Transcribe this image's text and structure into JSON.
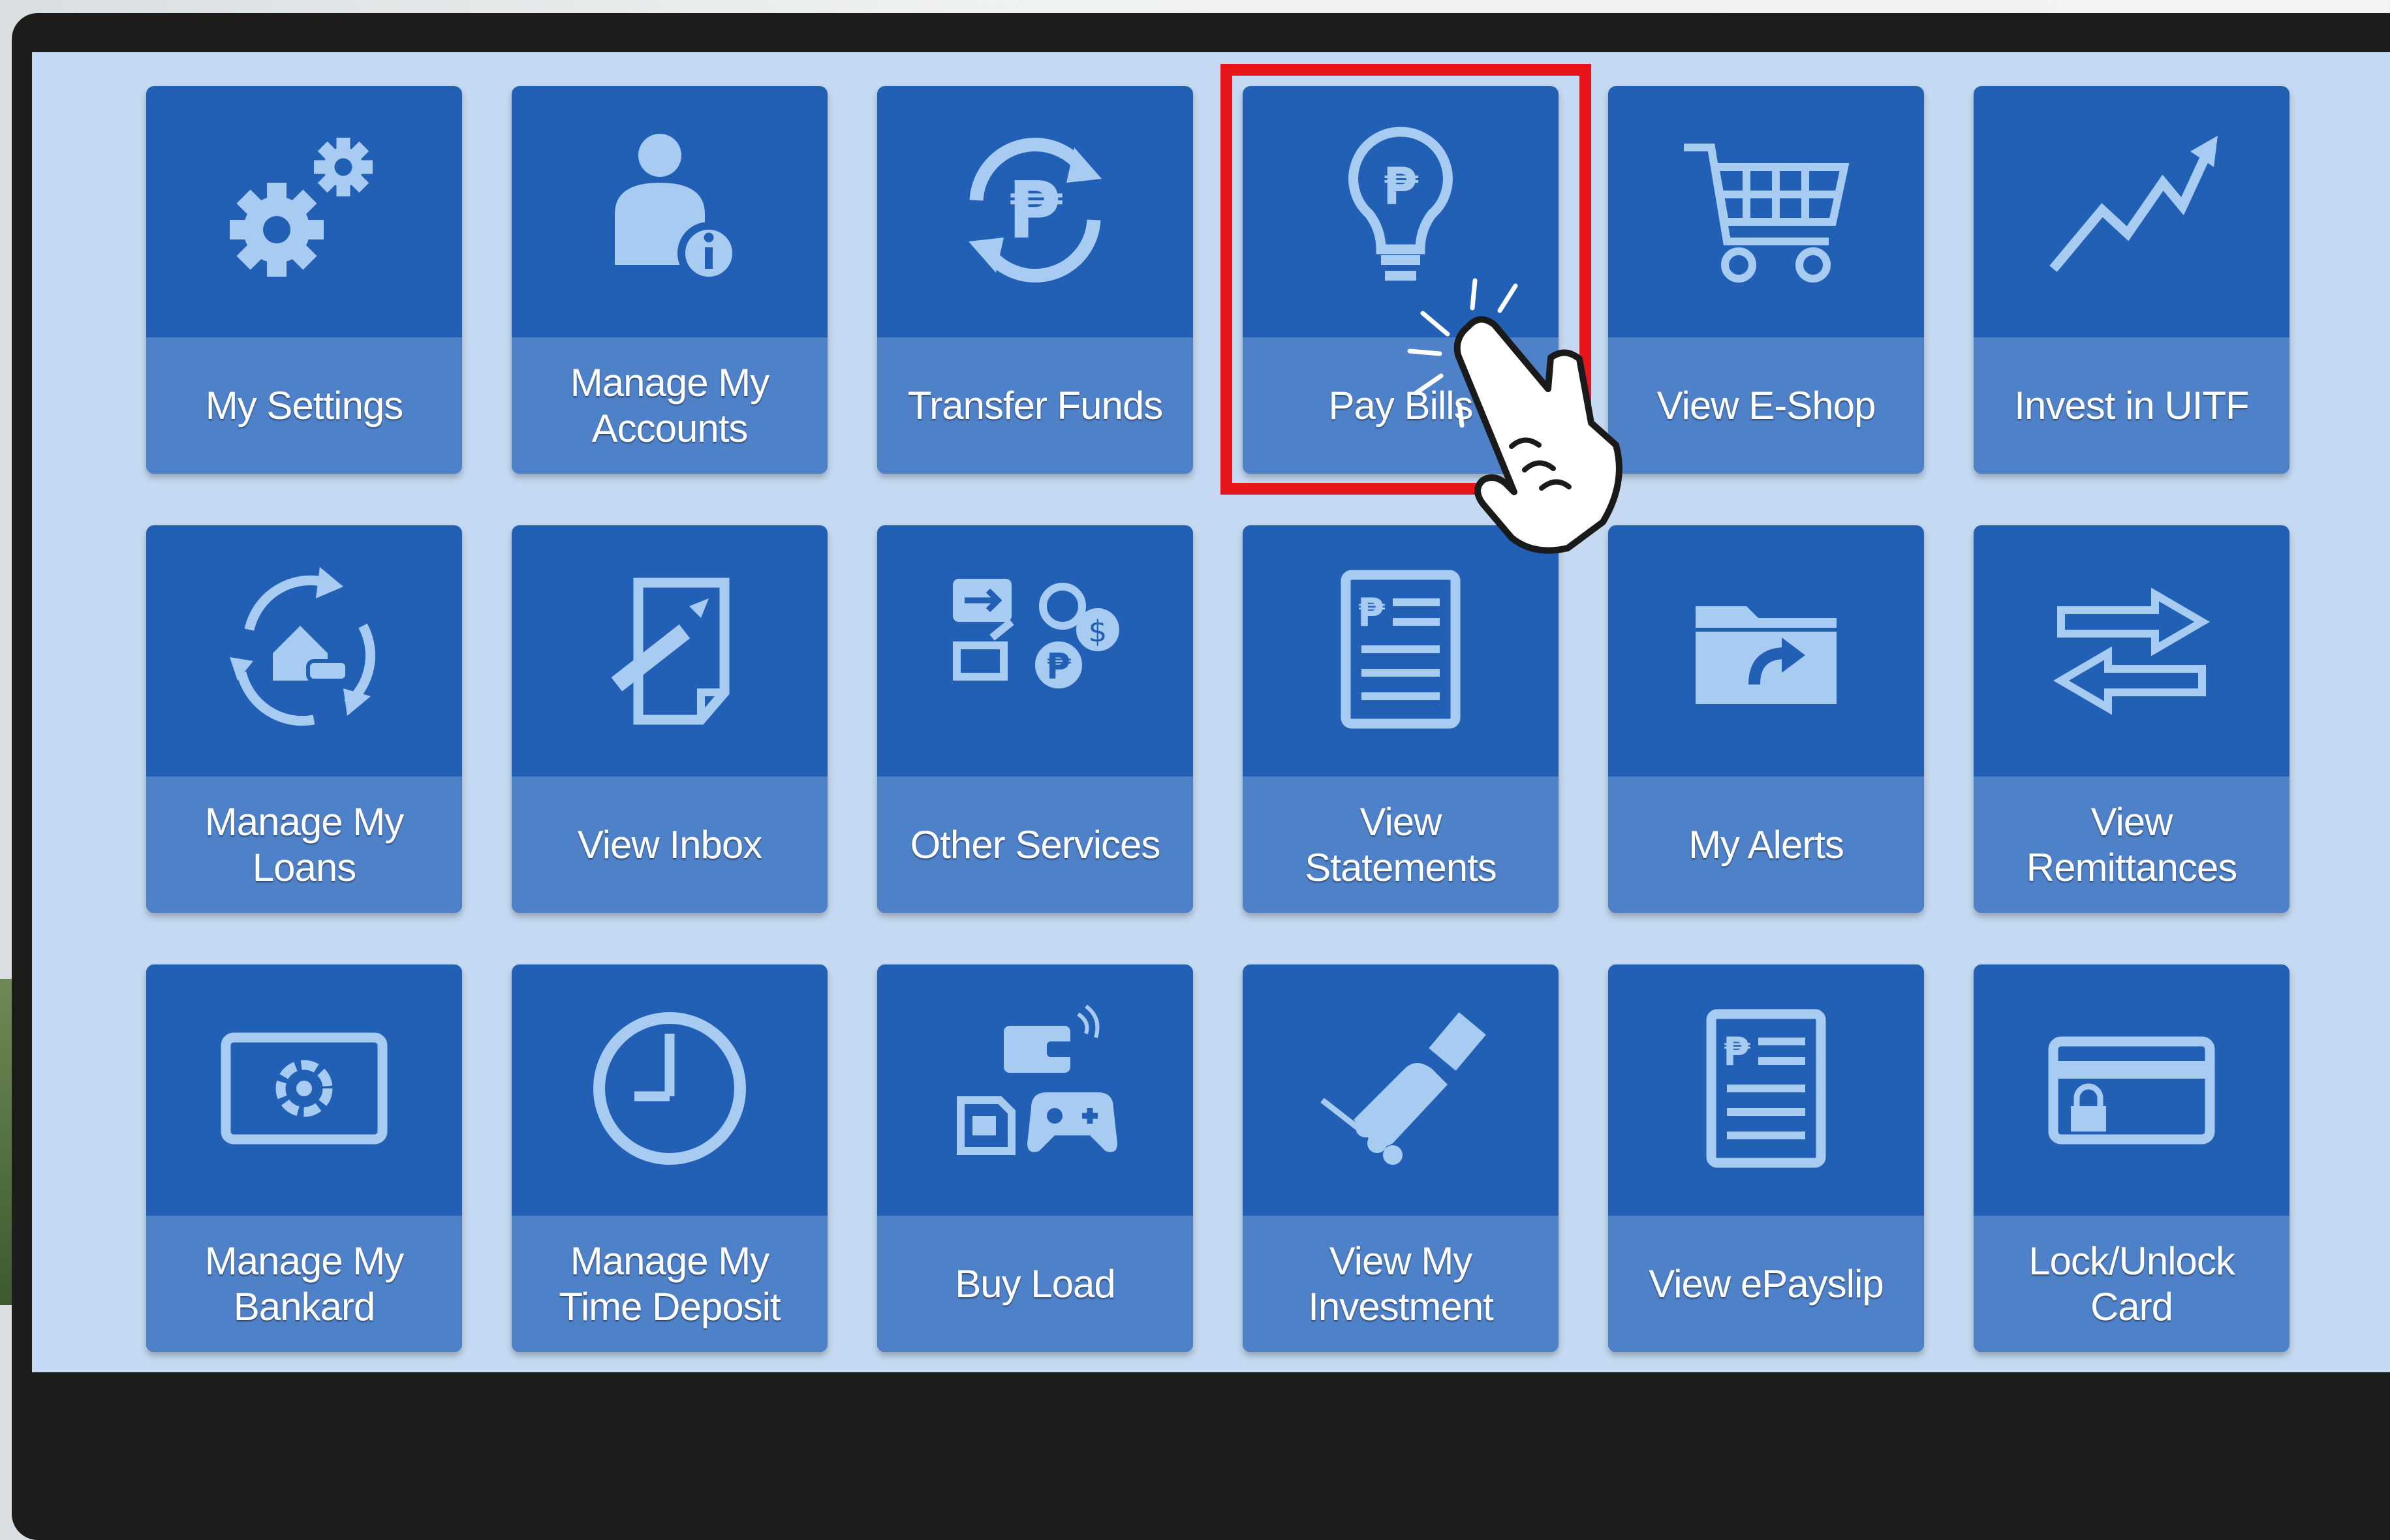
{
  "colors": {
    "screen_bg": "#c5daf2",
    "tile_top": "#2260b5",
    "tile_bottom": "#4f81c8",
    "icon": "#a8cbf2",
    "highlight": "#e8141b"
  },
  "tiles": [
    {
      "label": "My Settings",
      "icon": "gears-icon"
    },
    {
      "label": "Manage My\nAccounts",
      "icon": "account-info-icon"
    },
    {
      "label": "Transfer Funds",
      "icon": "peso-transfer-icon"
    },
    {
      "label": "Pay Bills",
      "icon": "lightbulb-peso-icon"
    },
    {
      "label": "View E-Shop",
      "icon": "shopping-cart-icon"
    },
    {
      "label": "Invest in UITF",
      "icon": "trend-up-icon"
    },
    {
      "label": "Manage My\nLoans",
      "icon": "house-car-cycle-icon"
    },
    {
      "label": "View Inbox",
      "icon": "compose-note-icon"
    },
    {
      "label": "Other Services",
      "icon": "services-coins-icon"
    },
    {
      "label": "View\nStatements",
      "icon": "statement-document-icon"
    },
    {
      "label": "My Alerts",
      "icon": "folder-arrow-icon"
    },
    {
      "label": "View\nRemittances",
      "icon": "exchange-arrows-icon"
    },
    {
      "label": "Manage My\nBankard",
      "icon": "bankard-card-icon"
    },
    {
      "label": "Manage My\nTime Deposit",
      "icon": "clock-icon"
    },
    {
      "label": "Buy Load",
      "icon": "wallet-sim-gamepad-icon"
    },
    {
      "label": "View My\nInvestment",
      "icon": "handshake-icon"
    },
    {
      "label": "View ePayslip",
      "icon": "payslip-document-icon"
    },
    {
      "label": "Lock/Unlock\nCard",
      "icon": "card-lock-icon"
    }
  ],
  "highlighted_tile": "Pay Bills",
  "pointer": "hand-pointer-icon"
}
